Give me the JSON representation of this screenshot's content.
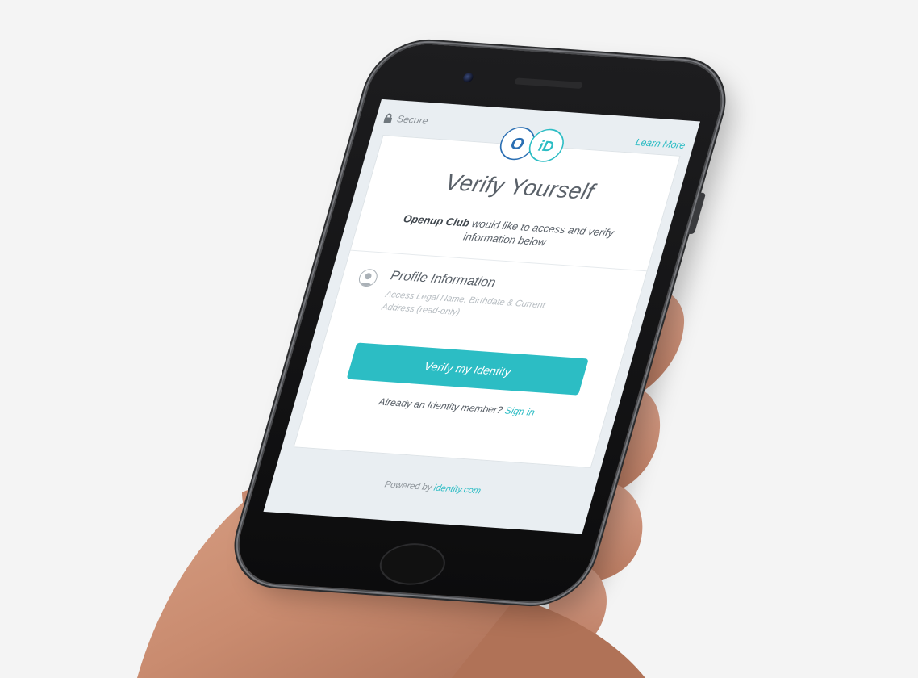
{
  "topbar": {
    "secure_label": "Secure",
    "learn_more_label": "Learn More"
  },
  "logo": {
    "left_glyph": "O",
    "right_glyph": "iD"
  },
  "card": {
    "title": "Verify Yourself",
    "intro_app_name": "Openup Club",
    "intro_text": " would like to access and verify information below"
  },
  "profile": {
    "title": "Profile Information",
    "description": "Access Legal Name, Birthdate & Current Address (read-only)"
  },
  "actions": {
    "verify_label": "Verify my Identity",
    "member_prompt": "Already an Identity member?",
    "signin_label": "Sign in"
  },
  "footer": {
    "powered_prefix": "Powered by",
    "powered_link": "identity.com"
  },
  "colors": {
    "accent": "#2cbdc4",
    "logo_blue": "#2b6fb3",
    "screen_bg": "#e9eef2",
    "text": "#5a6169"
  }
}
